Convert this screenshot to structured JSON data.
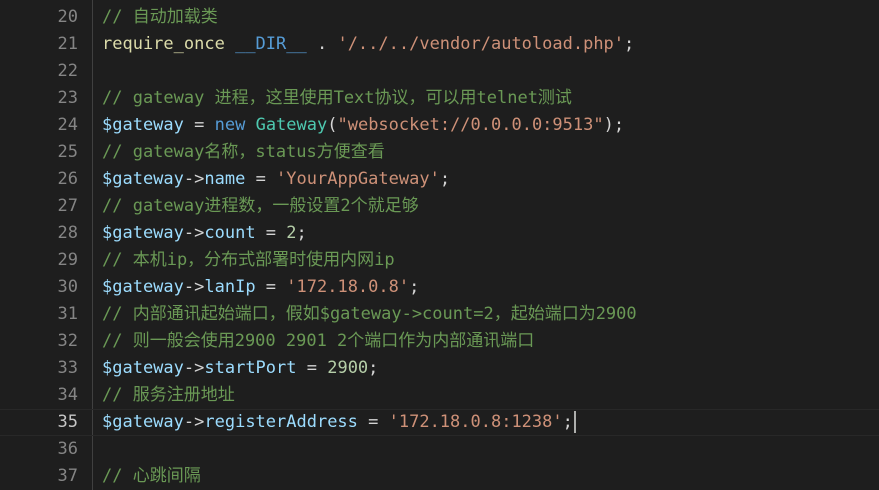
{
  "editor": {
    "lines": [
      {
        "number": "20",
        "tokens": [
          {
            "t": "cmt",
            "v": "// 自动加载类"
          }
        ]
      },
      {
        "number": "21",
        "tokens": [
          {
            "t": "fn",
            "v": "require_once"
          },
          {
            "t": "op",
            "v": " "
          },
          {
            "t": "kw",
            "v": "__DIR__"
          },
          {
            "t": "op",
            "v": " . "
          },
          {
            "t": "str",
            "v": "'/../../vendor/autoload.php'"
          },
          {
            "t": "op",
            "v": ";"
          }
        ]
      },
      {
        "number": "22",
        "tokens": []
      },
      {
        "number": "23",
        "tokens": [
          {
            "t": "cmt",
            "v": "// gateway 进程，这里使用Text协议，可以用telnet测试"
          }
        ]
      },
      {
        "number": "24",
        "tokens": [
          {
            "t": "var",
            "v": "$gateway"
          },
          {
            "t": "op",
            "v": " = "
          },
          {
            "t": "kw",
            "v": "new"
          },
          {
            "t": "op",
            "v": " "
          },
          {
            "t": "cls",
            "v": "Gateway"
          },
          {
            "t": "op",
            "v": "("
          },
          {
            "t": "str",
            "v": "\"websocket://0.0.0.0:9513\""
          },
          {
            "t": "op",
            "v": ");"
          }
        ]
      },
      {
        "number": "25",
        "tokens": [
          {
            "t": "cmt",
            "v": "// gateway名称，status方便查看"
          }
        ]
      },
      {
        "number": "26",
        "tokens": [
          {
            "t": "var",
            "v": "$gateway"
          },
          {
            "t": "op",
            "v": "->"
          },
          {
            "t": "var",
            "v": "name"
          },
          {
            "t": "op",
            "v": " = "
          },
          {
            "t": "str",
            "v": "'YourAppGateway'"
          },
          {
            "t": "op",
            "v": ";"
          }
        ]
      },
      {
        "number": "27",
        "tokens": [
          {
            "t": "cmt",
            "v": "// gateway进程数，一般设置2个就足够"
          }
        ]
      },
      {
        "number": "28",
        "tokens": [
          {
            "t": "var",
            "v": "$gateway"
          },
          {
            "t": "op",
            "v": "->"
          },
          {
            "t": "var",
            "v": "count"
          },
          {
            "t": "op",
            "v": " = "
          },
          {
            "t": "num",
            "v": "2"
          },
          {
            "t": "op",
            "v": ";"
          }
        ]
      },
      {
        "number": "29",
        "tokens": [
          {
            "t": "cmt",
            "v": "// 本机ip，分布式部署时使用内网ip"
          }
        ]
      },
      {
        "number": "30",
        "tokens": [
          {
            "t": "var",
            "v": "$gateway"
          },
          {
            "t": "op",
            "v": "->"
          },
          {
            "t": "var",
            "v": "lanIp"
          },
          {
            "t": "op",
            "v": " = "
          },
          {
            "t": "str",
            "v": "'172.18.0.8'"
          },
          {
            "t": "op",
            "v": ";"
          }
        ]
      },
      {
        "number": "31",
        "tokens": [
          {
            "t": "cmt",
            "v": "// 内部通讯起始端口，假如$gateway->count=2，起始端口为2900"
          }
        ]
      },
      {
        "number": "32",
        "tokens": [
          {
            "t": "cmt",
            "v": "// 则一般会使用2900 2901 2个端口作为内部通讯端口"
          }
        ]
      },
      {
        "number": "33",
        "tokens": [
          {
            "t": "var",
            "v": "$gateway"
          },
          {
            "t": "op",
            "v": "->"
          },
          {
            "t": "var",
            "v": "startPort"
          },
          {
            "t": "op",
            "v": " = "
          },
          {
            "t": "num",
            "v": "2900"
          },
          {
            "t": "op",
            "v": ";"
          }
        ]
      },
      {
        "number": "34",
        "tokens": [
          {
            "t": "cmt",
            "v": "// 服务注册地址"
          }
        ]
      },
      {
        "number": "35",
        "current": true,
        "tokens": [
          {
            "t": "var",
            "v": "$gateway"
          },
          {
            "t": "op",
            "v": "->"
          },
          {
            "t": "var",
            "v": "registerAddress"
          },
          {
            "t": "op",
            "v": " = "
          },
          {
            "t": "str",
            "v": "'172.18.0.8:1238'"
          },
          {
            "t": "op",
            "v": ";"
          }
        ]
      },
      {
        "number": "36",
        "tokens": []
      },
      {
        "number": "37",
        "tokens": [
          {
            "t": "cmt",
            "v": "// 心跳间隔"
          }
        ]
      }
    ]
  }
}
